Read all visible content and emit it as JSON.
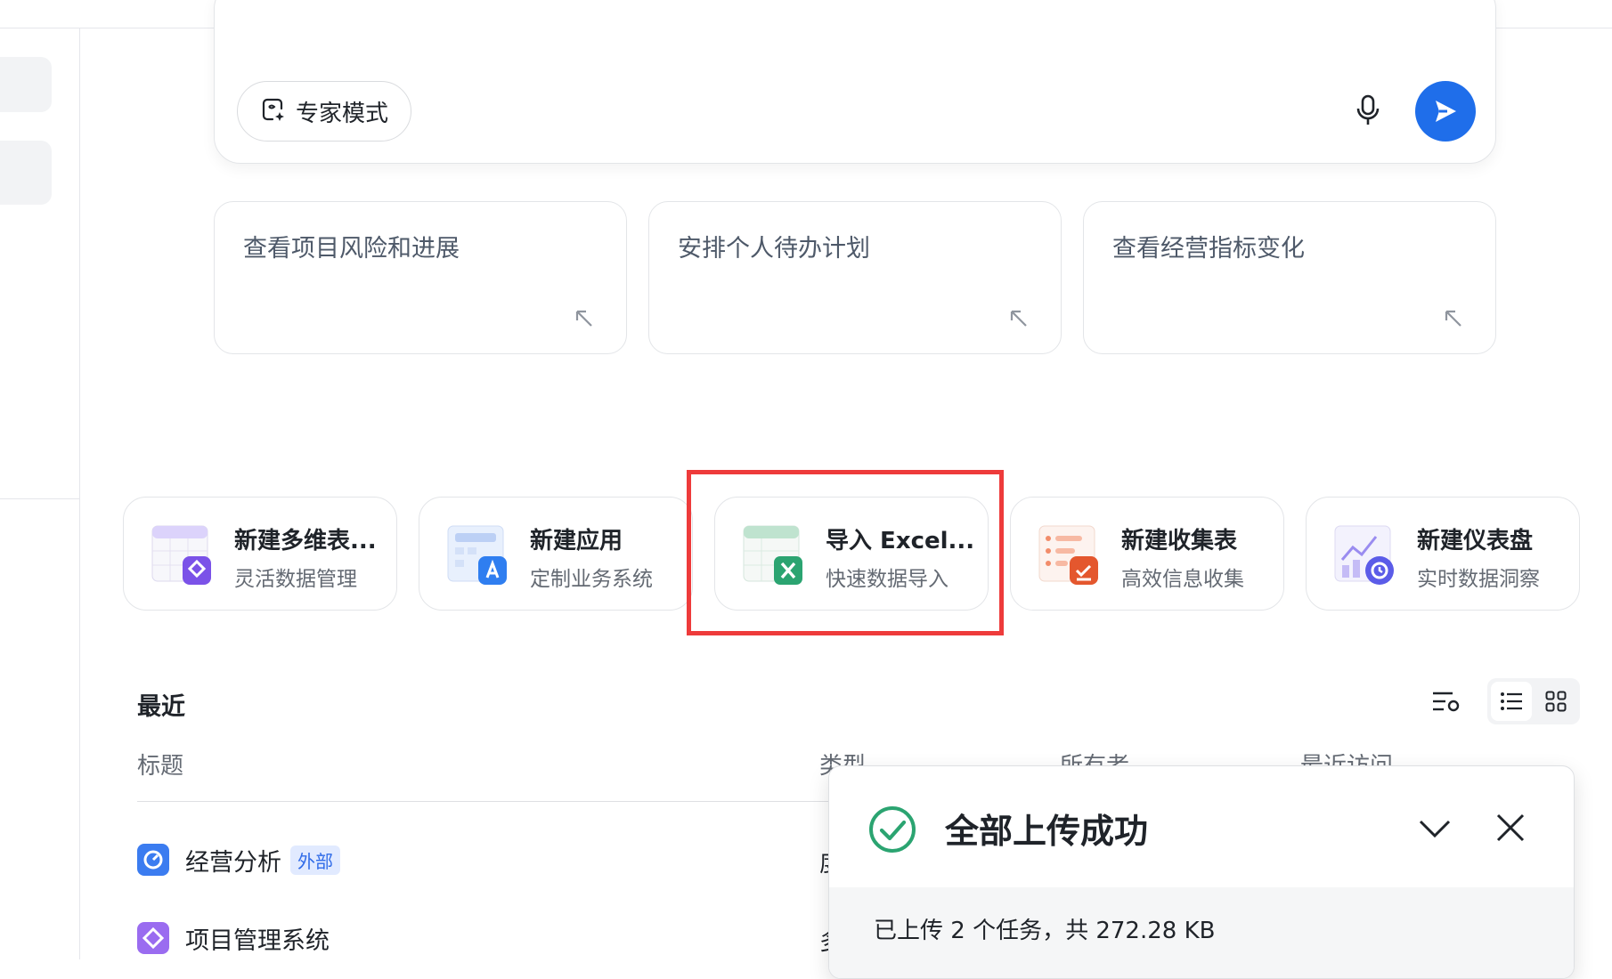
{
  "chat": {
    "expert_mode_label": "专家模式"
  },
  "prompts": [
    {
      "text": "查看项目风险和进展"
    },
    {
      "text": "安排个人待办计划"
    },
    {
      "text": "查看经营指标变化"
    }
  ],
  "quick_actions": [
    {
      "title": "新建多维表...",
      "subtitle": "灵活数据管理",
      "icon": "multi-dimensional-table-icon"
    },
    {
      "title": "新建应用",
      "subtitle": "定制业务系统",
      "icon": "app-builder-icon"
    },
    {
      "title": "导入 Excel...",
      "subtitle": "快速数据导入",
      "icon": "excel-import-icon"
    },
    {
      "title": "新建收集表",
      "subtitle": "高效信息收集",
      "icon": "form-collect-icon"
    },
    {
      "title": "新建仪表盘",
      "subtitle": "实时数据洞察",
      "icon": "dashboard-icon"
    }
  ],
  "recent": {
    "title": "最近",
    "columns": [
      "标题",
      "类型",
      "所有者",
      "最近访问"
    ],
    "rows": [
      {
        "name": "经营分析",
        "tag": "外部",
        "type_clip": "度"
      },
      {
        "name": "项目管理系统",
        "tag": "",
        "type_clip": "多"
      }
    ]
  },
  "toast": {
    "title": "全部上传成功",
    "summary": "已上传 2 个任务，共 272.28 KB"
  },
  "colors": {
    "accent": "#1f6eea",
    "success": "#2ba471",
    "highlight": "#ee3b3b"
  }
}
